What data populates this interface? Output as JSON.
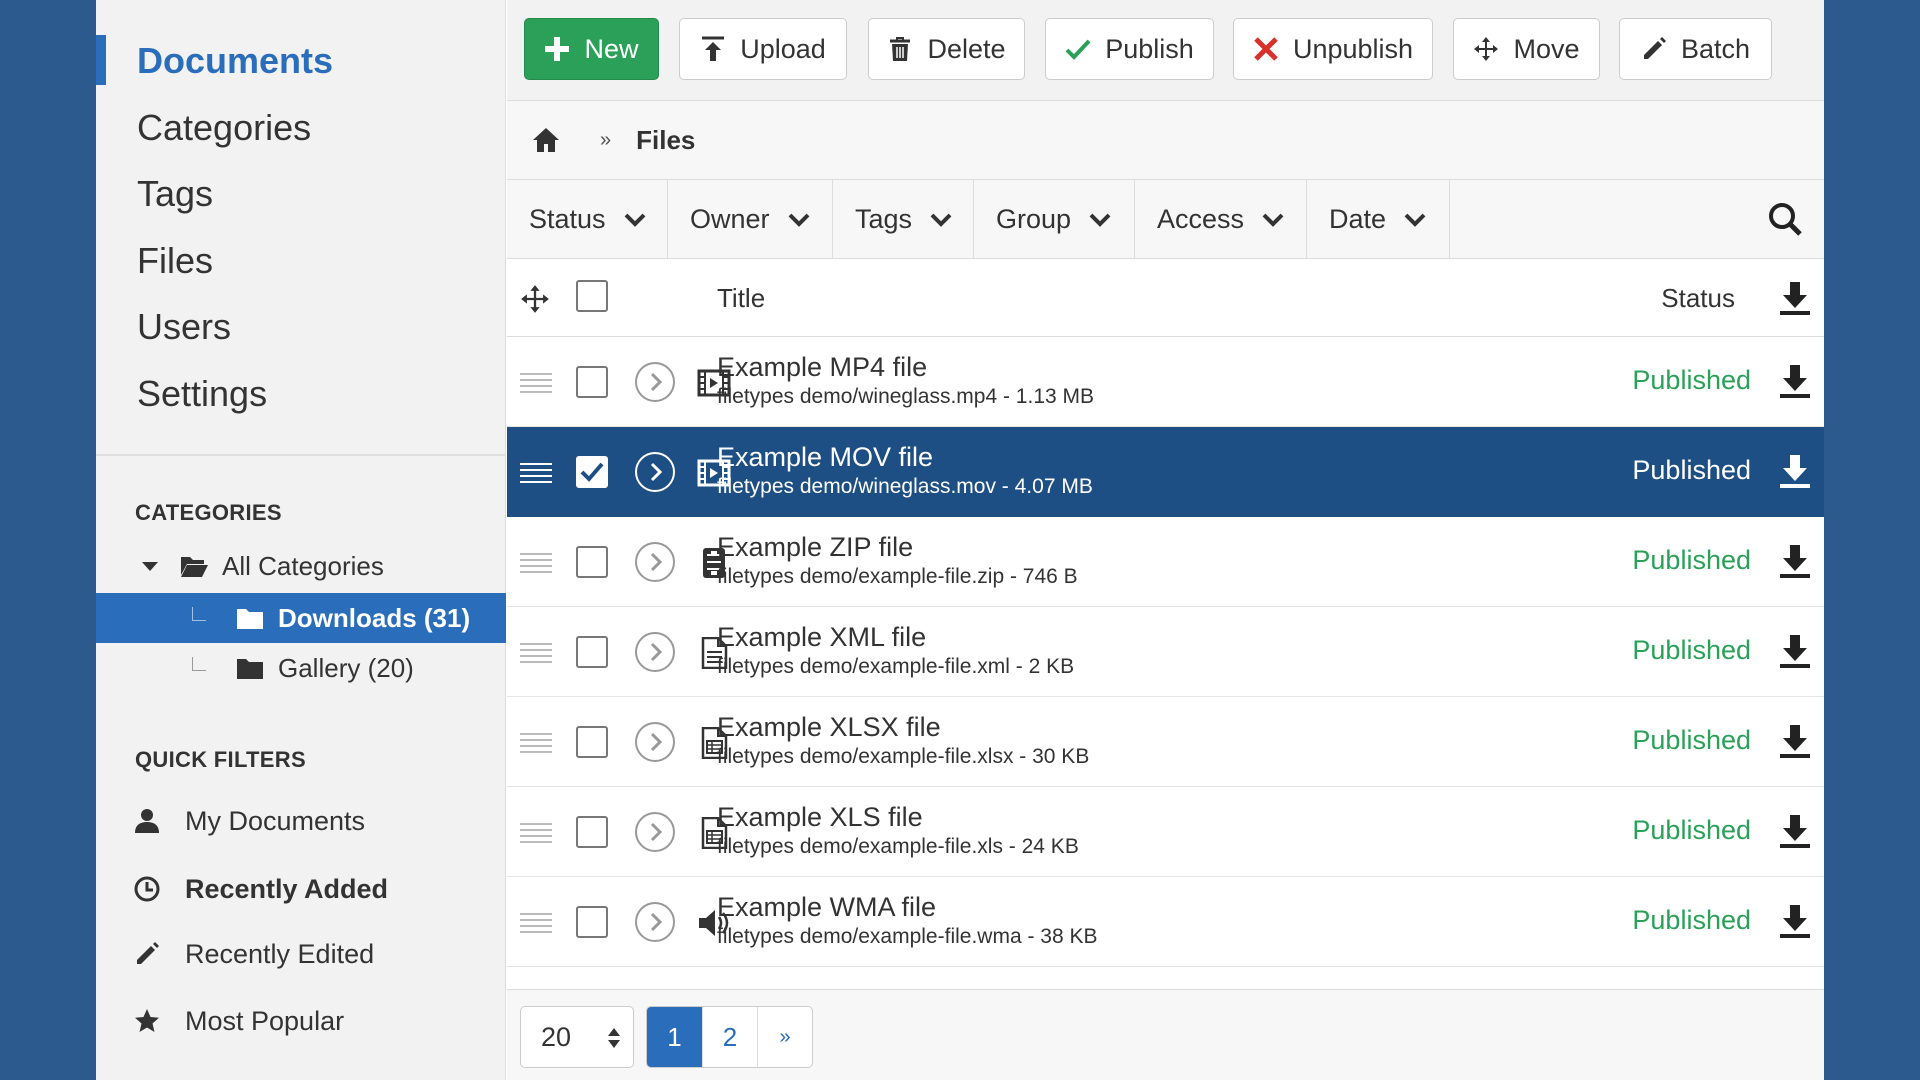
{
  "sidebar": {
    "nav": [
      {
        "label": "Documents"
      },
      {
        "label": "Categories"
      },
      {
        "label": "Tags"
      },
      {
        "label": "Files"
      },
      {
        "label": "Users"
      },
      {
        "label": "Settings"
      }
    ],
    "categories_heading": "CATEGORIES",
    "tree": {
      "all": "All Categories",
      "downloads": "Downloads (31)",
      "gallery": "Gallery (20)"
    },
    "quick_filters_heading": "QUICK FILTERS",
    "quick_filters": [
      {
        "label": "My Documents",
        "icon": "user-icon"
      },
      {
        "label": "Recently Added",
        "icon": "clock-icon"
      },
      {
        "label": "Recently Edited",
        "icon": "pencil-icon"
      },
      {
        "label": "Most Popular",
        "icon": "star-icon"
      }
    ]
  },
  "toolbar": {
    "new": "New",
    "upload": "Upload",
    "delete": "Delete",
    "publish": "Publish",
    "unpublish": "Unpublish",
    "move": "Move",
    "batch": "Batch"
  },
  "breadcrumb": {
    "separator": "»",
    "current": "Files"
  },
  "filters": [
    "Status",
    "Owner",
    "Tags",
    "Group",
    "Access",
    "Date"
  ],
  "list": {
    "header_title": "Title",
    "header_status": "Status",
    "rows": [
      {
        "title": "Example MP4 file",
        "meta": "filetypes demo/wineglass.mp4 - 1.13 MB",
        "status": "Published",
        "icon": "film-icon",
        "checked": false
      },
      {
        "title": "Example MOV file",
        "meta": "filetypes demo/wineglass.mov - 4.07 MB",
        "status": "Published",
        "icon": "film-icon",
        "checked": true
      },
      {
        "title": "Example ZIP file",
        "meta": "filetypes demo/example-file.zip - 746 B",
        "status": "Published",
        "icon": "archive-icon",
        "checked": false
      },
      {
        "title": "Example XML file",
        "meta": "filetypes demo/example-file.xml - 2 KB",
        "status": "Published",
        "icon": "document-icon",
        "checked": false
      },
      {
        "title": "Example XLSX file",
        "meta": "filetypes demo/example-file.xlsx - 30 KB",
        "status": "Published",
        "icon": "spreadsheet-icon",
        "checked": false
      },
      {
        "title": "Example XLS file",
        "meta": "filetypes demo/example-file.xls - 24 KB",
        "status": "Published",
        "icon": "spreadsheet-icon",
        "checked": false
      },
      {
        "title": "Example WMA file",
        "meta": "filetypes demo/example-file.wma - 38 KB",
        "status": "Published",
        "icon": "audio-icon",
        "checked": false
      }
    ]
  },
  "pagination": {
    "page_size": "20",
    "pages": [
      "1",
      "2"
    ],
    "next": "»",
    "current_page": "1"
  },
  "colors": {
    "background": "#2d5a8e",
    "accent": "#2a6ebb",
    "selected_row": "#1e4f84",
    "published": "#2aa058",
    "new_button": "#2aa058",
    "unpublish_icon": "#d9302c"
  }
}
